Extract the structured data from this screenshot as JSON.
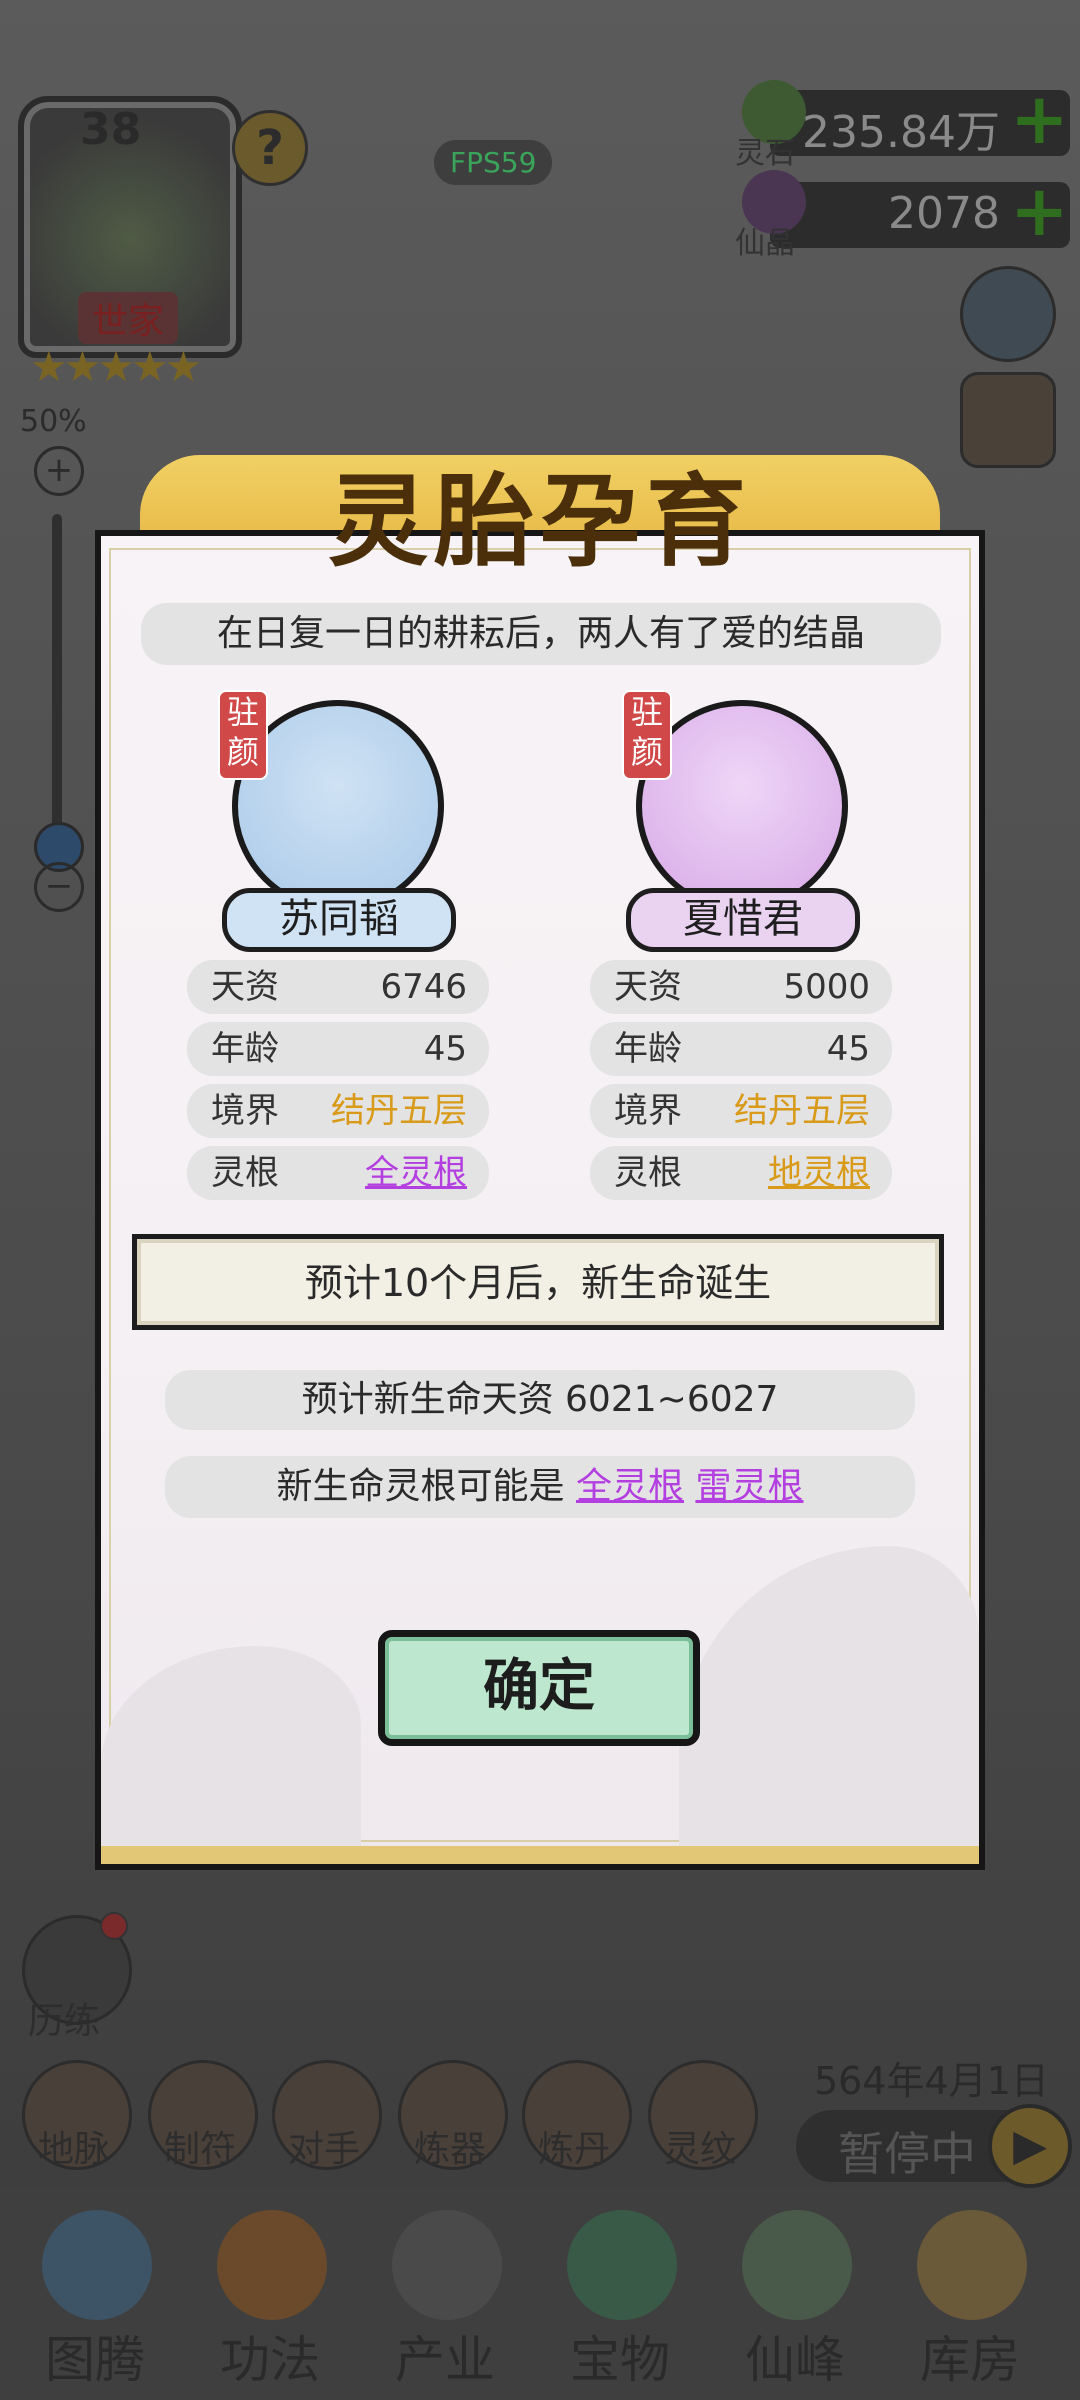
{
  "hud": {
    "family_level": "38",
    "family_name": "世家",
    "stars": "★★★★★",
    "help": "?",
    "fps": "FPS59",
    "zoom_percent": "50%",
    "zoom_plus": "+",
    "zoom_minus": "−",
    "resources": [
      {
        "label": "灵石",
        "value": "235.84万",
        "plus": "+"
      },
      {
        "label": "仙晶",
        "value": "2078",
        "plus": "+"
      }
    ]
  },
  "dialog": {
    "title": "灵胎孕育",
    "story": "在日复一日的耕耘后，两人有了爱的结晶",
    "parents": [
      {
        "badge": "驻颜",
        "name": "苏同韬",
        "stats": [
          {
            "key": "天资",
            "value": "6746"
          },
          {
            "key": "年龄",
            "value": "45"
          },
          {
            "key": "境界",
            "value": "结丹五层"
          },
          {
            "key": "灵根",
            "value": "全灵根"
          }
        ]
      },
      {
        "badge": "驻颜",
        "name": "夏惜君",
        "stats": [
          {
            "key": "天资",
            "value": "5000"
          },
          {
            "key": "年龄",
            "value": "45"
          },
          {
            "key": "境界",
            "value": "结丹五层"
          },
          {
            "key": "灵根",
            "value": "地灵根"
          }
        ]
      }
    ],
    "notice": "预计10个月后，新生命诞生",
    "aptitude_prefix": "预计新生命天资",
    "aptitude_range": "6021~6027",
    "root_prefix": "新生命灵根可能是",
    "root_options": [
      "全灵根",
      "雷灵根"
    ],
    "confirm": "确定"
  },
  "game": {
    "date": "564年4月1日",
    "pause": "暂停中",
    "history": "历练",
    "quick_actions": [
      "地脉",
      "制符",
      "对手",
      "炼器",
      "炼丹",
      "灵纹"
    ],
    "bottom_nav": [
      "图腾",
      "功法",
      "产业",
      "宝物",
      "仙峰",
      "库房"
    ]
  },
  "colors": {
    "gold": "#d89a18",
    "purple": "#b43fe0",
    "confirm_bg": "#bde8cf",
    "male_avatar_bg": "#a9c9e8",
    "female_avatar_bg": "#d6a8e6"
  }
}
